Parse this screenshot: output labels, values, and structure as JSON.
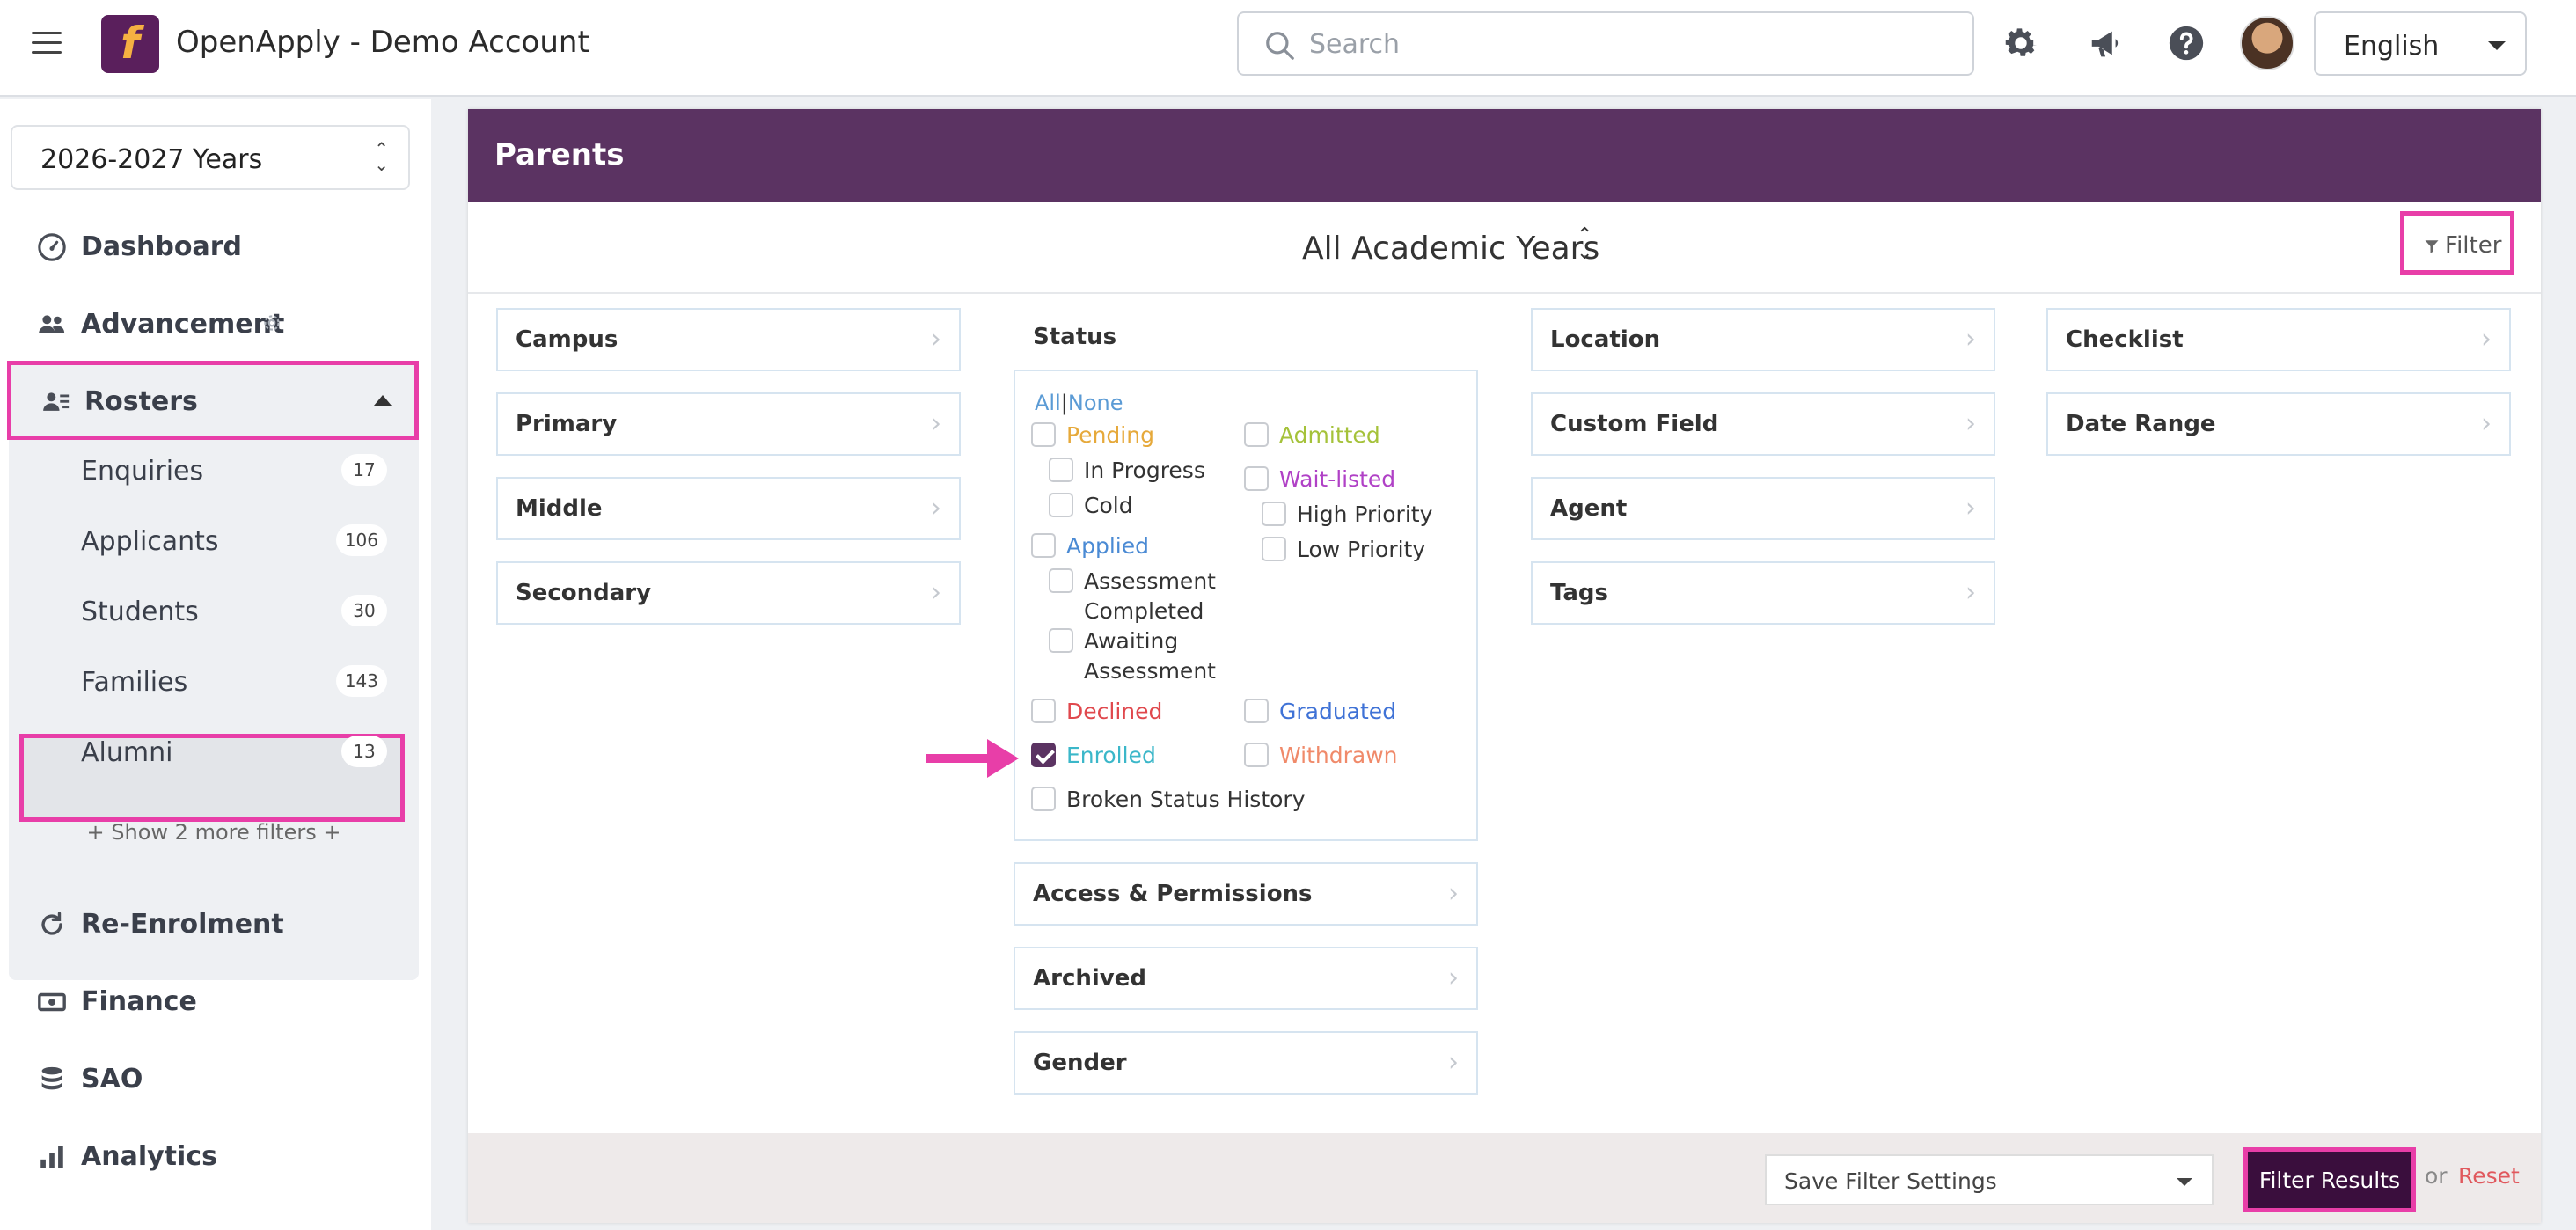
{
  "topbar": {
    "logo_letter": "f",
    "app_title": "OpenApply - Demo Account",
    "search_placeholder": "Search",
    "language": "English",
    "icons": [
      "menu-icon",
      "settings-gear-icon",
      "megaphone-icon",
      "help-icon",
      "user-avatar"
    ]
  },
  "sidebar": {
    "year_select": "2026-2027 Years",
    "nav": {
      "dashboard": "Dashboard",
      "advancement": "Advancement",
      "rosters": "Rosters",
      "reenrolment": "Re-Enrolment",
      "finance": "Finance",
      "sao": "SAO",
      "analytics": "Analytics"
    },
    "roster_items": [
      {
        "label": "Enquiries",
        "count": "17"
      },
      {
        "label": "Applicants",
        "count": "106"
      },
      {
        "label": "Students",
        "count": "30"
      },
      {
        "label": "Families",
        "count": "143"
      },
      {
        "label": "Alumni",
        "count": "13"
      }
    ],
    "show_more": "+ Show 2 more filters +"
  },
  "panel": {
    "title": "Parents",
    "academic_years": "All Academic Years",
    "filter_button": "Filter",
    "filters_col1": [
      "Campus",
      "Primary",
      "Middle",
      "Secondary"
    ],
    "filters_col3": [
      "Location",
      "Custom Field",
      "Agent",
      "Tags"
    ],
    "filters_col4": [
      "Checklist",
      "Date Range"
    ],
    "filters_col2_bottom": [
      "Access & Permissions",
      "Archived",
      "Gender"
    ],
    "status": {
      "title": "Status",
      "all": "All",
      "none": "None",
      "options": {
        "pending": "Pending",
        "in_progress": "In Progress",
        "cold": "Cold",
        "applied": "Applied",
        "assessment_completed_1": "Assessment",
        "assessment_completed_2": "Completed",
        "awaiting_assessment_1": "Awaiting",
        "awaiting_assessment_2": "Assessment",
        "declined": "Declined",
        "enrolled": "Enrolled",
        "broken_status_history": "Broken Status History",
        "admitted": "Admitted",
        "wait_listed": "Wait-listed",
        "high_priority": "High Priority",
        "low_priority": "Low Priority",
        "graduated": "Graduated",
        "withdrawn": "Withdrawn"
      },
      "checked": [
        "enrolled"
      ]
    },
    "bottom": {
      "save_filter": "Save Filter Settings",
      "filter_results": "Filter Results",
      "or": "or",
      "reset": "Reset"
    }
  },
  "colors": {
    "brand_purple": "#5b3362",
    "highlight_pink": "#e83ea8",
    "pending": "#e6a93a",
    "applied": "#4a8ad4",
    "declined": "#e0484d",
    "enrolled": "#3bb7c9",
    "admitted": "#a5c23a",
    "wait_listed": "#b041c6",
    "graduated": "#3f72d6",
    "withdrawn": "#f08a6a"
  }
}
